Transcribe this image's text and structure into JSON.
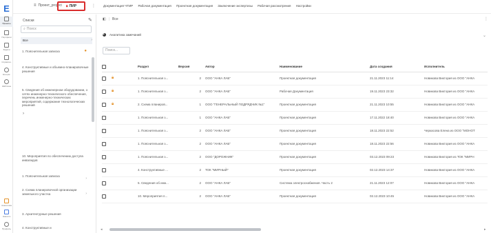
{
  "rail": {
    "logo": "E",
    "items": [
      {
        "label": "Проекты",
        "icon": "building-icon"
      },
      {
        "label": "Портфели",
        "icon": "portfolio-icon"
      },
      {
        "label": "Задачи",
        "icon": "tasks-icon"
      },
      {
        "label": "Справочн.",
        "icon": "directory-icon"
      },
      {
        "label": "Контраг.",
        "icon": "contractors-icon"
      },
      {
        "label": "Шаблоны",
        "icon": "templates-icon"
      },
      {
        "label": "Аналитика",
        "icon": "analytics-icon"
      },
      {
        "label": "Новости",
        "icon": "news-icon"
      },
      {
        "label": "Профиль",
        "icon": "profile-icon"
      }
    ]
  },
  "topbar": {
    "project_btn": "Проект_project",
    "pir_tab": "ПИР",
    "tabs": [
      "Документация ЧТИР",
      "Рабочая документация",
      "Проектная документация",
      "Заключение экспертизы",
      "Рабочая рассмотрения",
      "Настройки"
    ]
  },
  "tree": {
    "title": "Списки",
    "search_placeholder": "Поиск",
    "items": [
      "Все",
      "1. Пояснительная записка",
      "4. Конструктивные и объемно-планировочные решения",
      "5. Сведения об инженерном оборудовании, о сетях инженерно-технического обеспечения, перечень инженерно-технических мероприятий, содержание технологических решений",
      "10. Мероприятия по обеспечению доступа инвалидов",
      "1. Пояснительная записка",
      "2. Схема планировочной организации земельного участка",
      "3. Архитектурные решения",
      "4. Конструктивные и"
    ]
  },
  "main": {
    "header": "Все",
    "analytics_label": "Аналитика замечаний",
    "filter_placeholder": "Поиск...",
    "columns": [
      "Раздел",
      "Версия",
      "Автор",
      "Наименование",
      "Дата создания",
      "Исполнитель"
    ],
    "rows": [
      {
        "lock": true,
        "section": "1. Пояснительная з...",
        "version": "2",
        "author": "ООО \"АНКА ЛАБ\"",
        "name": "Проектная документация",
        "date": "21.11.2023 11:14",
        "executor": "Новикова Виктория из ООО \"АНКА"
      },
      {
        "lock": true,
        "section": "1. Пояснительная з...",
        "version": "2",
        "author": "ООО \"АНКА ЛАБ\"",
        "name": "Рабочая Документация",
        "date": "19.11.2023 23:32",
        "executor": "Новикова Виктория из ООО \"АНКА"
      },
      {
        "lock": true,
        "section": "2. Схема планиров...",
        "version": "1",
        "author": "ООО \"ГЕНЕРАЛЬНЫЙ ПОДРЯДЧИК №1\"",
        "name": "Проектная документация",
        "date": "21.11.2023 10:55",
        "executor": "Новикова Виктория из ООО \"АНКА"
      },
      {
        "lock": false,
        "section": "1. Пояснительная з...",
        "version": "1",
        "author": "ООО \"АНКА ЛАБ\"",
        "name": "Проектная документация",
        "date": "17.11.2022 18:40",
        "executor": "Новикова Виктория из ООО \"АНКА"
      },
      {
        "lock": false,
        "section": "1. Пояснительная з...",
        "version": "2",
        "author": "ООО \"АНКА ЛАБ\"",
        "name": "Проектная документация",
        "date": "18.11.2023 22:52",
        "executor": "Черкасова Елена из ООО \"МОНОТ"
      },
      {
        "lock": false,
        "section": "1. Пояснительная з...",
        "version": "2",
        "author": "ООО \"АНКА ЛАБ\"",
        "name": "Проектная документация",
        "date": "18.11.2023 22:56",
        "executor": "Новикова Виктория из ООО \"АНКА"
      },
      {
        "lock": false,
        "section": "1. Пояснительная з...",
        "version": "2",
        "author": "ООО \"ДОРОЖНИК\"",
        "name": "Проектная документация",
        "date": "03.12.2023 09:23",
        "executor": "Новикова Виктория из ТОК \"МИРН"
      },
      {
        "lock": false,
        "section": "4. Конструктивные ...",
        "version": "2",
        "author": "ТОК \"МИРНЫЙ\"",
        "name": "Проектная документация",
        "date": "02.12.2023 14:37",
        "executor": "Новикова Виктория из ООО \"АНКА"
      },
      {
        "lock": false,
        "section": "5. Сведения об инж...",
        "version": "2",
        "author": "ООО \"АНКА ЛАБ\"",
        "name": "Система электроснабжения. Часть 2",
        "date": "21.11.2023 12:07",
        "executor": "Новикова Виктория из ООО \"АНКА"
      },
      {
        "lock": false,
        "section": "10. Мероприятия п...",
        "version": "2",
        "author": "ООО \"АНКА ЛАБ\"",
        "name": "Проектная документация",
        "date": "02.12.2023 10:45",
        "executor": "Новикова Виктория из ООО \"АНКА"
      }
    ]
  }
}
